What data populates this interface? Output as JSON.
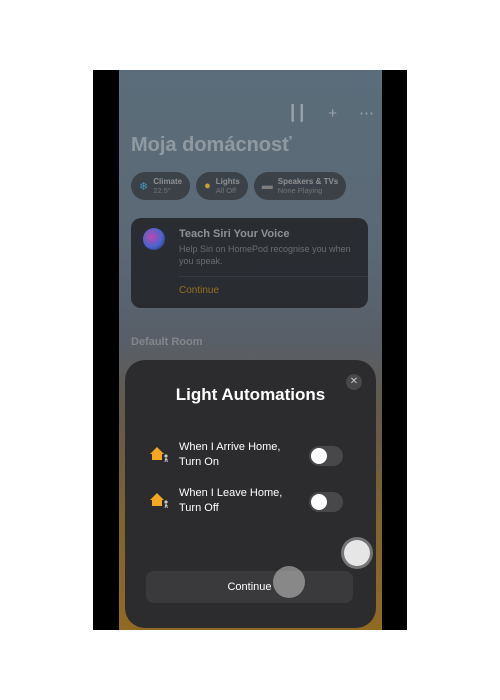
{
  "topbar": {
    "icons": [
      "waveform-icon",
      "plus-icon",
      "more-icon"
    ]
  },
  "home": {
    "title": "Moja domácnosť",
    "chips": [
      {
        "name": "Climate",
        "status": "22.5°",
        "icon": "snowflake-icon"
      },
      {
        "name": "Lights",
        "status": "All Off",
        "icon": "lightbulb-icon"
      },
      {
        "name": "Speakers & TVs",
        "status": "None Playing",
        "icon": "speaker-tv-icon"
      }
    ],
    "siri_card": {
      "title": "Teach Siri Your Voice",
      "body": "Help Siri on HomePod recognise you when you speak.",
      "link": "Continue"
    },
    "section": "Default Room"
  },
  "sheet": {
    "title": "Light Automations",
    "rows": [
      {
        "label_line1": "When I Arrive Home,",
        "label_line2": "Turn On",
        "enabled": false
      },
      {
        "label_line1": "When I Leave Home,",
        "label_line2": "Turn Off",
        "enabled": false
      }
    ],
    "continue": "Continue"
  },
  "colors": {
    "accent": "#b8862a",
    "home_icon": "#f5a623",
    "sheet_bg": "#2c2c2e"
  }
}
